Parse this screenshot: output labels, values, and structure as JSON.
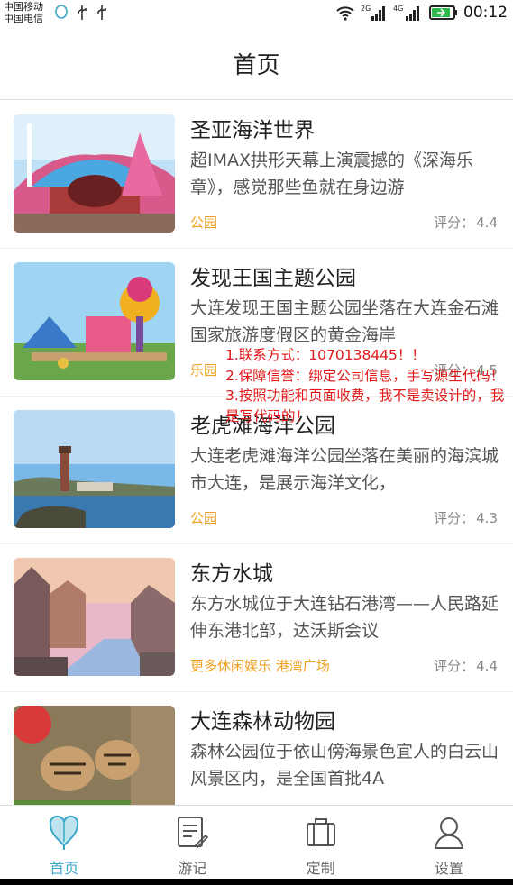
{
  "statusbar": {
    "carrier1": "中国移动",
    "carrier2": "中国电信",
    "net1": "2G",
    "net2": "4G",
    "time": "00:12"
  },
  "header": {
    "title": "首页"
  },
  "items": [
    {
      "title": "圣亚海洋世界",
      "desc": "超IMAX拱形天幕上演震撼的《深海乐章》，感觉那些鱼就在身边游",
      "tag": "公园",
      "rating_label": "评分：",
      "rating": "4.4"
    },
    {
      "title": "发现王国主题公园",
      "desc": "大连发现王国主题公园坐落在大连金石滩国家旅游度假区的黄金海岸",
      "tag": "乐园",
      "rating_label": "评分：",
      "rating": "4.5"
    },
    {
      "title": "老虎滩海洋公园",
      "desc": "大连老虎滩海洋公园坐落在美丽的海滨城市大连，是展示海洋文化，",
      "tag": "公园",
      "rating_label": "评分：",
      "rating": "4.3"
    },
    {
      "title": "东方水城",
      "desc": "东方水城位于大连钻石港湾——人民路延伸东港北部，达沃斯会议",
      "tag": "更多休闲娱乐 港湾广场",
      "rating_label": "评分：",
      "rating": "4.4"
    },
    {
      "title": "大连森林动物园",
      "desc": "森林公园位于依山傍海景色宜人的白云山风景区内，是全国首批4A",
      "tag": "",
      "rating_label": "",
      "rating": ""
    }
  ],
  "overlay": {
    "line1": "1.联系方式：1070138445！！",
    "line2": "2.保障信誉：绑定公司信息，手写源生代码！",
    "line3": "3.按照功能和页面收费，我不是卖设计的，我是写代码的！"
  },
  "tabs": [
    {
      "label": "首页",
      "icon": "heart-pin-icon",
      "active": true
    },
    {
      "label": "游记",
      "icon": "notebook-pen-icon",
      "active": false
    },
    {
      "label": "定制",
      "icon": "briefcase-icon",
      "active": false
    },
    {
      "label": "设置",
      "icon": "user-icon",
      "active": false
    }
  ],
  "colors": {
    "accent": "#3aa6c8",
    "tag": "#f0a020",
    "overlay_text": "#e21818"
  }
}
